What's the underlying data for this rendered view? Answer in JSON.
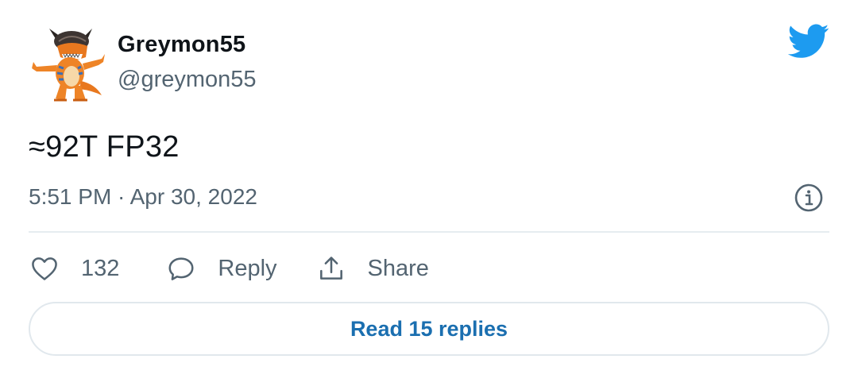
{
  "author": {
    "display_name": "Greymon55",
    "handle": "@greymon55",
    "avatar_icon": "orange-dinosaur-avatar"
  },
  "brand": {
    "icon": "twitter-bird-icon",
    "color": "#1d9bf0"
  },
  "tweet": {
    "text": "≈92T FP32",
    "timestamp": "5:51 PM · Apr 30, 2022"
  },
  "actions": {
    "like_count": "132",
    "reply_label": "Reply",
    "share_label": "Share"
  },
  "read_replies_label": "Read 15 replies",
  "colors": {
    "text_primary": "#0f1419",
    "text_secondary": "#536471",
    "link": "#1b6fb0",
    "divider": "#e6ecf0"
  }
}
